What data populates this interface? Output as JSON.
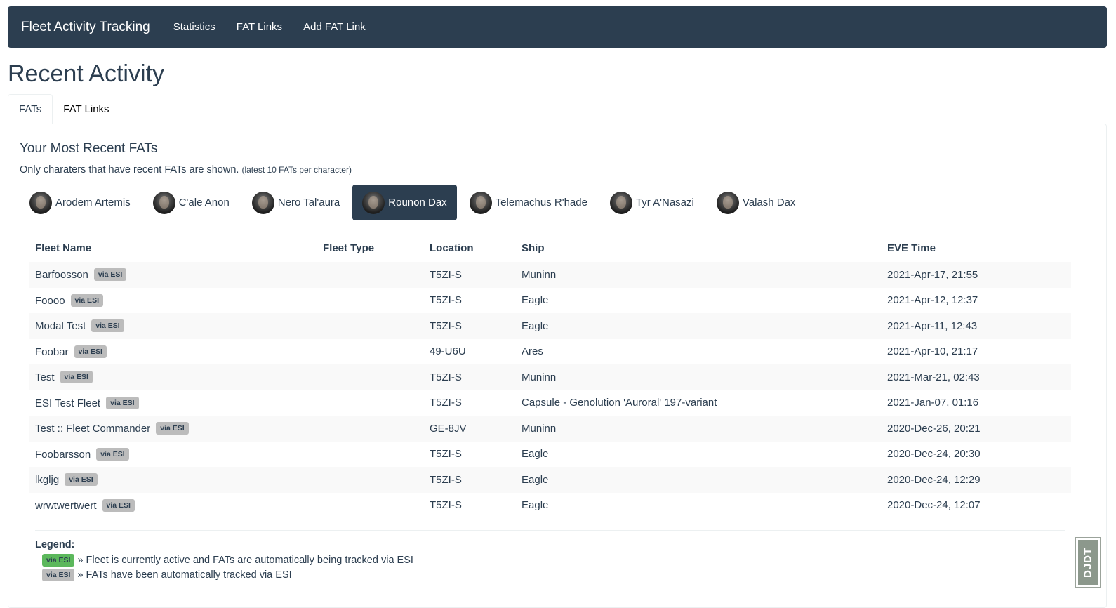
{
  "navbar": {
    "brand": "Fleet Activity Tracking",
    "links": [
      "Statistics",
      "FAT Links",
      "Add FAT Link"
    ]
  },
  "page": {
    "title": "Recent Activity"
  },
  "tabs": [
    {
      "label": "FATs",
      "active": true
    },
    {
      "label": "FAT Links",
      "active": false
    }
  ],
  "section": {
    "title": "Your Most Recent FATs",
    "desc": "Only charaters that have recent FATs are shown.",
    "desc_small": "(latest 10 FATs per character)"
  },
  "characters": [
    {
      "name": "Arodem Artemis",
      "active": false
    },
    {
      "name": "C'ale Anon",
      "active": false
    },
    {
      "name": "Nero Tal'aura",
      "active": false
    },
    {
      "name": "Rounon Dax",
      "active": true
    },
    {
      "name": "Telemachus R'hade",
      "active": false
    },
    {
      "name": "Tyr A'Nasazi",
      "active": false
    },
    {
      "name": "Valash Dax",
      "active": false
    }
  ],
  "table": {
    "headers": [
      "Fleet Name",
      "Fleet Type",
      "Location",
      "Ship",
      "EVE Time"
    ],
    "badge": "via ESI",
    "rows": [
      {
        "fleet": "Barfoosson",
        "type": "",
        "location": "T5ZI-S",
        "ship": "Muninn",
        "time": "2021-Apr-17, 21:55"
      },
      {
        "fleet": "Foooo",
        "type": "",
        "location": "T5ZI-S",
        "ship": "Eagle",
        "time": "2021-Apr-12, 12:37"
      },
      {
        "fleet": "Modal Test",
        "type": "",
        "location": "T5ZI-S",
        "ship": "Eagle",
        "time": "2021-Apr-11, 12:43"
      },
      {
        "fleet": "Foobar",
        "type": "",
        "location": "49-U6U",
        "ship": "Ares",
        "time": "2021-Apr-10, 21:17"
      },
      {
        "fleet": "Test",
        "type": "",
        "location": "T5ZI-S",
        "ship": "Muninn",
        "time": "2021-Mar-21, 02:43"
      },
      {
        "fleet": "ESI Test Fleet",
        "type": "",
        "location": "T5ZI-S",
        "ship": "Capsule - Genolution 'Auroral' 197-variant",
        "time": "2021-Jan-07, 01:16"
      },
      {
        "fleet": "Test :: Fleet Commander",
        "type": "",
        "location": "GE-8JV",
        "ship": "Muninn",
        "time": "2020-Dec-26, 20:21"
      },
      {
        "fleet": "Foobarsson",
        "type": "",
        "location": "T5ZI-S",
        "ship": "Eagle",
        "time": "2020-Dec-24, 20:30"
      },
      {
        "fleet": "lkgljg",
        "type": "",
        "location": "T5ZI-S",
        "ship": "Eagle",
        "time": "2020-Dec-24, 12:29"
      },
      {
        "fleet": "wrwtwertwert",
        "type": "",
        "location": "T5ZI-S",
        "ship": "Eagle",
        "time": "2020-Dec-24, 12:07"
      }
    ]
  },
  "legend": {
    "title": "Legend:",
    "items": [
      {
        "badge": "via ESI",
        "color": "#5cb85c",
        "text": "» Fleet is currently active and FATs are automatically being tracked via ESI"
      },
      {
        "badge": "via ESI",
        "color": "#bcbcbc",
        "text": "» FATs have been automatically tracked via ESI"
      }
    ]
  },
  "debug_toolbar": {
    "label": "DJDT"
  },
  "colors": {
    "primary": "#2c3e50",
    "badge_grey": "#bcbcbc",
    "badge_green": "#5cb85c"
  }
}
